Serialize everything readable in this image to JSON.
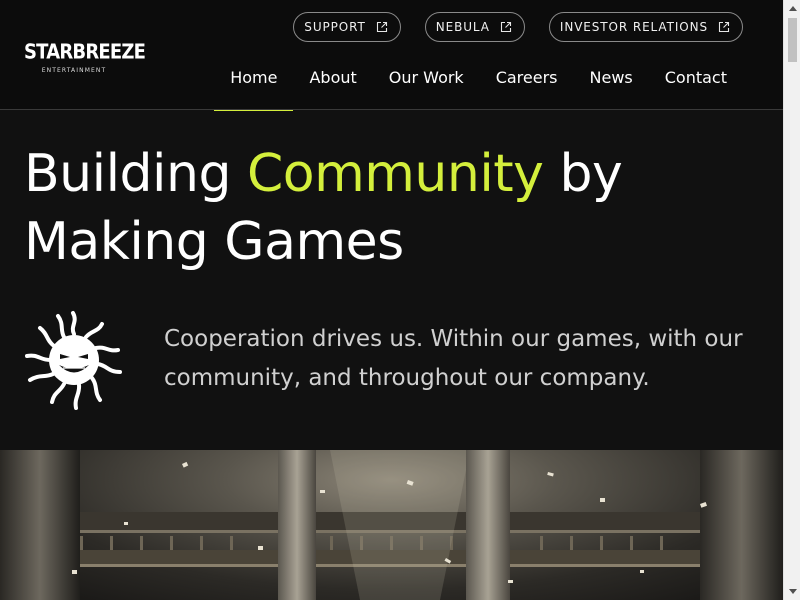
{
  "brand": {
    "name": "STARBREEZE",
    "subtitle": "ENTERTAINMENT"
  },
  "utility_nav": [
    {
      "label": "SUPPORT",
      "icon": "external-link-icon"
    },
    {
      "label": "NEBULA",
      "icon": "external-link-icon"
    },
    {
      "label": "INVESTOR RELATIONS",
      "icon": "external-link-icon"
    }
  ],
  "main_nav": [
    {
      "label": "Home",
      "active": true
    },
    {
      "label": "About",
      "active": false
    },
    {
      "label": "Our Work",
      "active": false
    },
    {
      "label": "Careers",
      "active": false
    },
    {
      "label": "News",
      "active": false
    },
    {
      "label": "Contact",
      "active": false
    }
  ],
  "hero": {
    "title_part1": "Building ",
    "title_accent": "Community",
    "title_part2": " by",
    "title_line2": "Making Games",
    "tagline": "Cooperation drives us. Within our games, with our community, and throughout our company."
  },
  "colors": {
    "background": "#111111",
    "accent": "#d4ef3c",
    "text": "#ffffff",
    "muted_text": "#d0d0d0"
  }
}
